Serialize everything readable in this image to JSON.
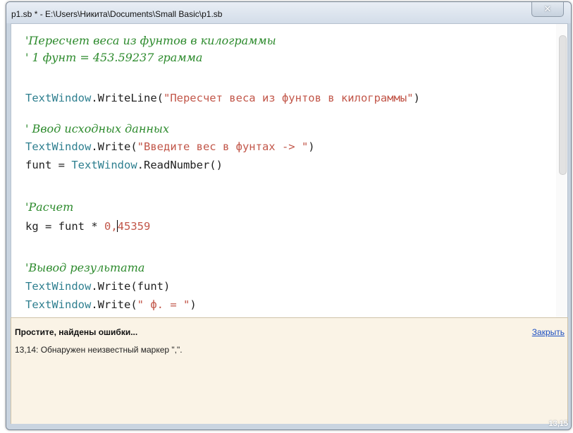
{
  "window": {
    "title": "p1.sb * - E:\\Users\\Никита\\Documents\\Small Basic\\p1.sb",
    "close_glyph": "✕"
  },
  "code": {
    "comment1": "'Пересчет веса из фунтов в килограммы",
    "comment2": "' 1 фунт = 453.59237 грамма",
    "line3_obj": "TextWindow",
    "line3_method": ".WriteLine(",
    "line3_str": "\"Пересчет веса из фунтов в килограммы\"",
    "line3_close": ")",
    "comment4": "' Ввод исходных данных",
    "line5_obj": "TextWindow",
    "line5_method": ".Write(",
    "line5_str": "\"Введите вес в фунтах -> \"",
    "line5_close": ")",
    "line6_var": "funt = ",
    "line6_obj": "TextWindow",
    "line6_method": ".ReadNumber()",
    "comment7": "'Расчет",
    "line8_var": "kg = funt * ",
    "line8_num_a": "0,",
    "line8_num_b": "45359",
    "comment9": "'Вывод результата",
    "line10_obj": "TextWindow",
    "line10_method": ".Write(funt)",
    "line11_obj": "TextWindow",
    "line11_method": ".Write(",
    "line11_str": "\" ф. = \"",
    "line11_close": ")"
  },
  "errors": {
    "title": "Простите, найдены ошибки...",
    "close_label": "Закрыть",
    "message": "13,14: Обнаружен неизвестный маркер \",\"."
  },
  "status": {
    "cursor_position": "13,15"
  },
  "colors": {
    "comment": "#2c8a2c",
    "object": "#2e7f8f",
    "string": "#c2574a",
    "error_panel_bg": "#faf3e6",
    "link": "#1a4ec2"
  }
}
